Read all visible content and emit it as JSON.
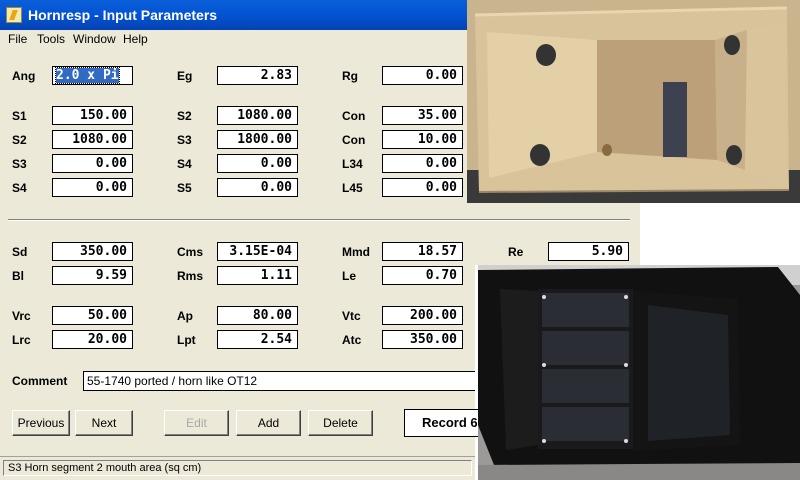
{
  "window": {
    "title": "Hornresp - Input Parameters",
    "menu": [
      "File",
      "Tools",
      "Window",
      "Help"
    ]
  },
  "params": {
    "Ang": {
      "label": "Ang",
      "value": "2.0 x Pi"
    },
    "Eg": {
      "label": "Eg",
      "value": "2.83"
    },
    "Rg": {
      "label": "Rg",
      "value": "0.00"
    },
    "S1": {
      "label": "S1",
      "value": "150.00"
    },
    "S2a": {
      "label": "S2",
      "value": "1080.00"
    },
    "Con1": {
      "label": "Con",
      "value": "35.00"
    },
    "S2b": {
      "label": "S2",
      "value": "1080.00"
    },
    "S3a": {
      "label": "S3",
      "value": "1800.00"
    },
    "Con2": {
      "label": "Con",
      "value": "10.00"
    },
    "S3b": {
      "label": "S3",
      "value": "0.00"
    },
    "S4a": {
      "label": "S4",
      "value": "0.00"
    },
    "L34": {
      "label": "L34",
      "value": "0.00"
    },
    "S4b": {
      "label": "S4",
      "value": "0.00"
    },
    "S5": {
      "label": "S5",
      "value": "0.00"
    },
    "L45": {
      "label": "L45",
      "value": "0.00"
    },
    "Sd": {
      "label": "Sd",
      "value": "350.00"
    },
    "Cms": {
      "label": "Cms",
      "value": "3.15E-04"
    },
    "Mmd": {
      "label": "Mmd",
      "value": "18.57"
    },
    "Re": {
      "label": "Re",
      "value": "5.90"
    },
    "Bl": {
      "label": "Bl",
      "value": "9.59"
    },
    "Rms": {
      "label": "Rms",
      "value": "1.11"
    },
    "Le": {
      "label": "Le",
      "value": "0.70"
    },
    "Vrc": {
      "label": "Vrc",
      "value": "50.00"
    },
    "Ap": {
      "label": "Ap",
      "value": "80.00"
    },
    "Vtc": {
      "label": "Vtc",
      "value": "200.00"
    },
    "Lrc": {
      "label": "Lrc",
      "value": "20.00"
    },
    "Lpt": {
      "label": "Lpt",
      "value": "2.54"
    },
    "Atc": {
      "label": "Atc",
      "value": "350.00"
    }
  },
  "comment": {
    "label": "Comment",
    "value": "55-1740 ported / horn like OT12"
  },
  "buttons": {
    "previous": "Previous",
    "next": "Next",
    "edit": "Edit",
    "add": "Add",
    "delete": "Delete"
  },
  "record": "Record 6",
  "status": "S3   Horn segment 2 mouth area  (sq cm)"
}
